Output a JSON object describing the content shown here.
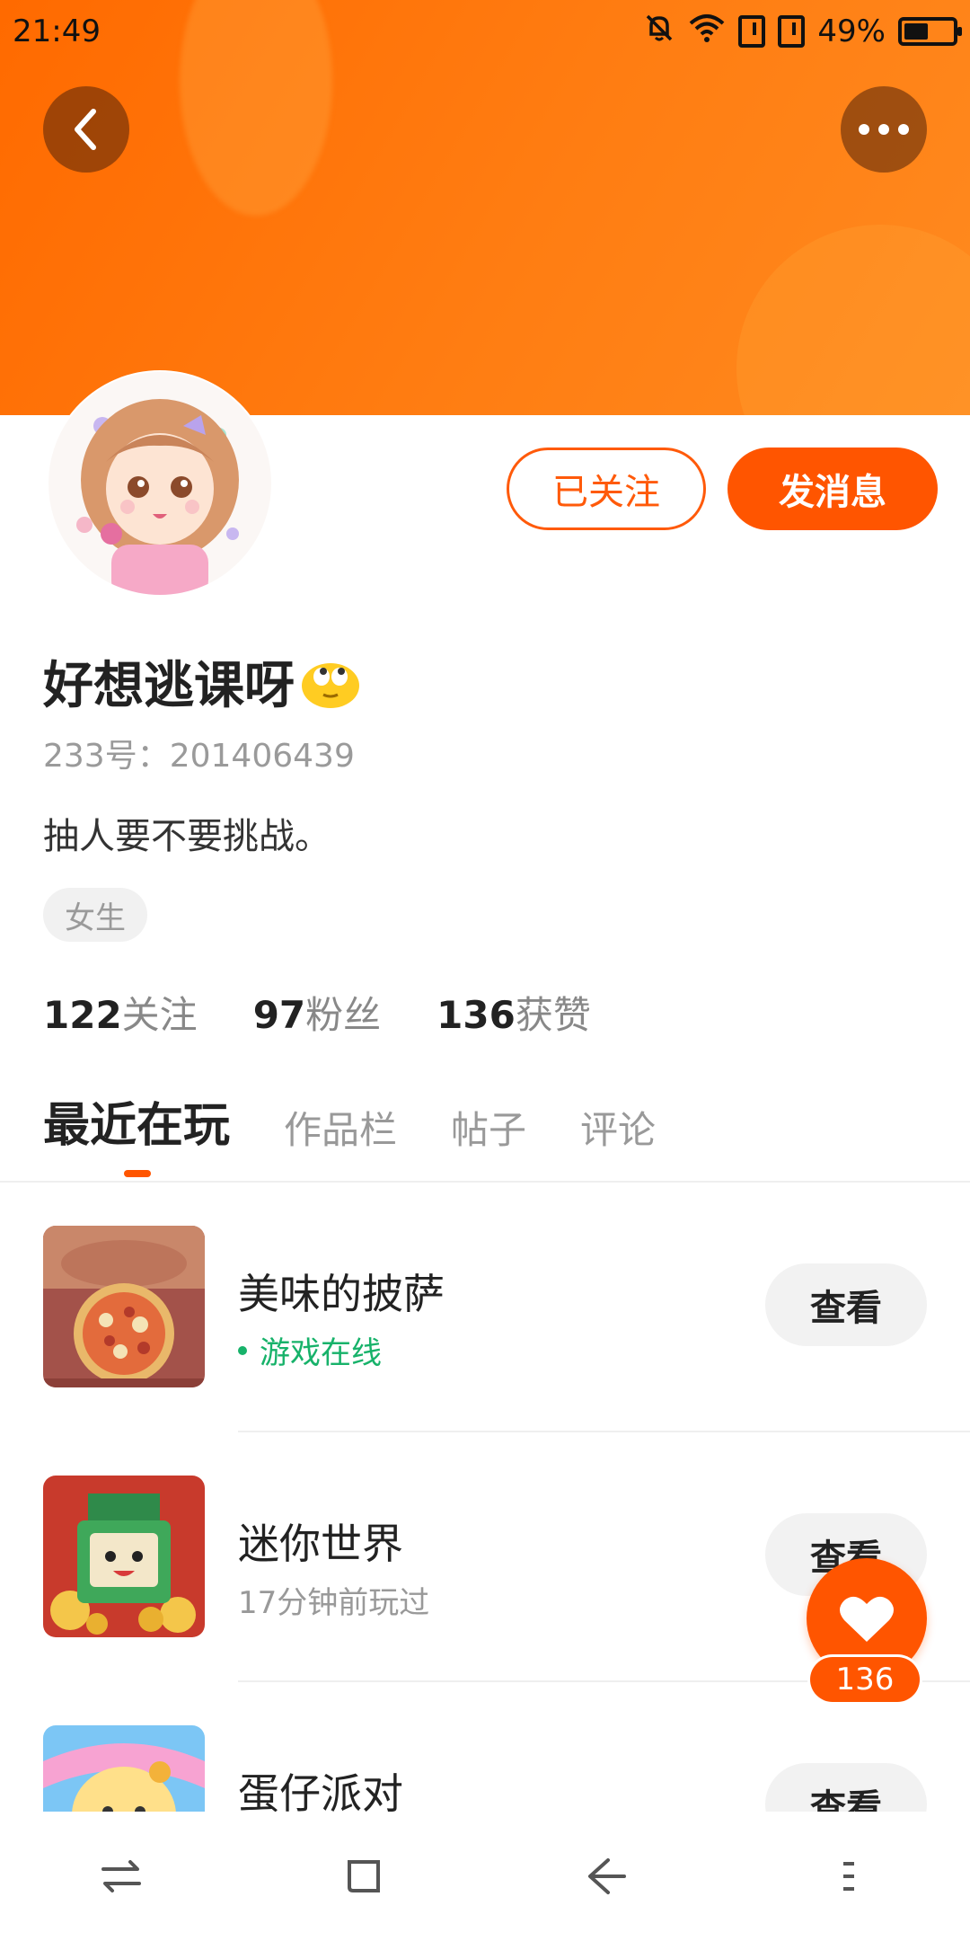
{
  "status_bar": {
    "time": "21:49",
    "battery": "49%",
    "battery_level": 0.49
  },
  "profile": {
    "follow_label": "已关注",
    "message_label": "发消息",
    "username": "好想逃课呀",
    "uid": "233号：201406439",
    "bio": "抽人要不要挑战。",
    "gender_tag": "女生"
  },
  "stats": {
    "following_num": "122",
    "following_label": "关注",
    "fans_num": "97",
    "fans_label": "粉丝",
    "likes_num": "136",
    "likes_label": "获赞"
  },
  "tabs": [
    {
      "label": "最近在玩"
    },
    {
      "label": "作品栏"
    },
    {
      "label": "帖子"
    },
    {
      "label": "评论"
    }
  ],
  "games": [
    {
      "title": "美味的披萨",
      "status": "游戏在线",
      "view_label": "查看"
    },
    {
      "title": "迷你世界",
      "status": "17分钟前玩过",
      "view_label": "查看"
    },
    {
      "title": "蛋仔派对",
      "status": "",
      "view_label": "查看"
    }
  ],
  "like_fab": {
    "count": "136"
  },
  "colors": {
    "accent": "#ff5500",
    "header": "#ff7a10",
    "online": "#17b26a"
  },
  "icons": [
    "back-icon",
    "more-icon",
    "mute-bell-icon",
    "wifi-icon",
    "sim-icon",
    "battery-icon",
    "heart-icon",
    "switch-icon",
    "home-icon",
    "back-nav-icon",
    "menu-icon"
  ]
}
